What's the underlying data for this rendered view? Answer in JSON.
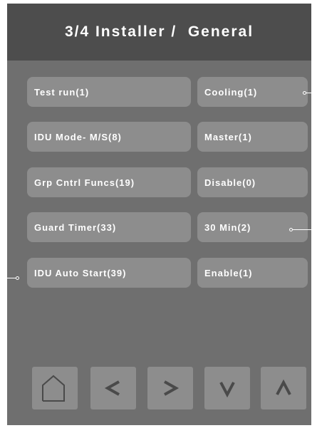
{
  "header": {
    "title": "3/4 Installer /  General"
  },
  "settings": [
    {
      "name": "Test run(1)",
      "value": "Cooling(1)"
    },
    {
      "name": "IDU Mode- M/S(8)",
      "value": "Master(1)"
    },
    {
      "name": "Grp Cntrl Funcs(19)",
      "value": "Disable(0)"
    },
    {
      "name": "Guard Timer(33)",
      "value": "30 Min(2)"
    },
    {
      "name": "IDU Auto Start(39)",
      "value": "Enable(1)"
    }
  ],
  "nav": {
    "icons": [
      "home-icon",
      "chevron-left-icon",
      "chevron-right-icon",
      "chevron-down-icon",
      "chevron-up-icon"
    ]
  },
  "colors": {
    "panel": "#6f6f6f",
    "header": "#4d4d4d",
    "button": "#8d8d8d",
    "icon": "#4a4a4a",
    "text": "#ffffff"
  }
}
